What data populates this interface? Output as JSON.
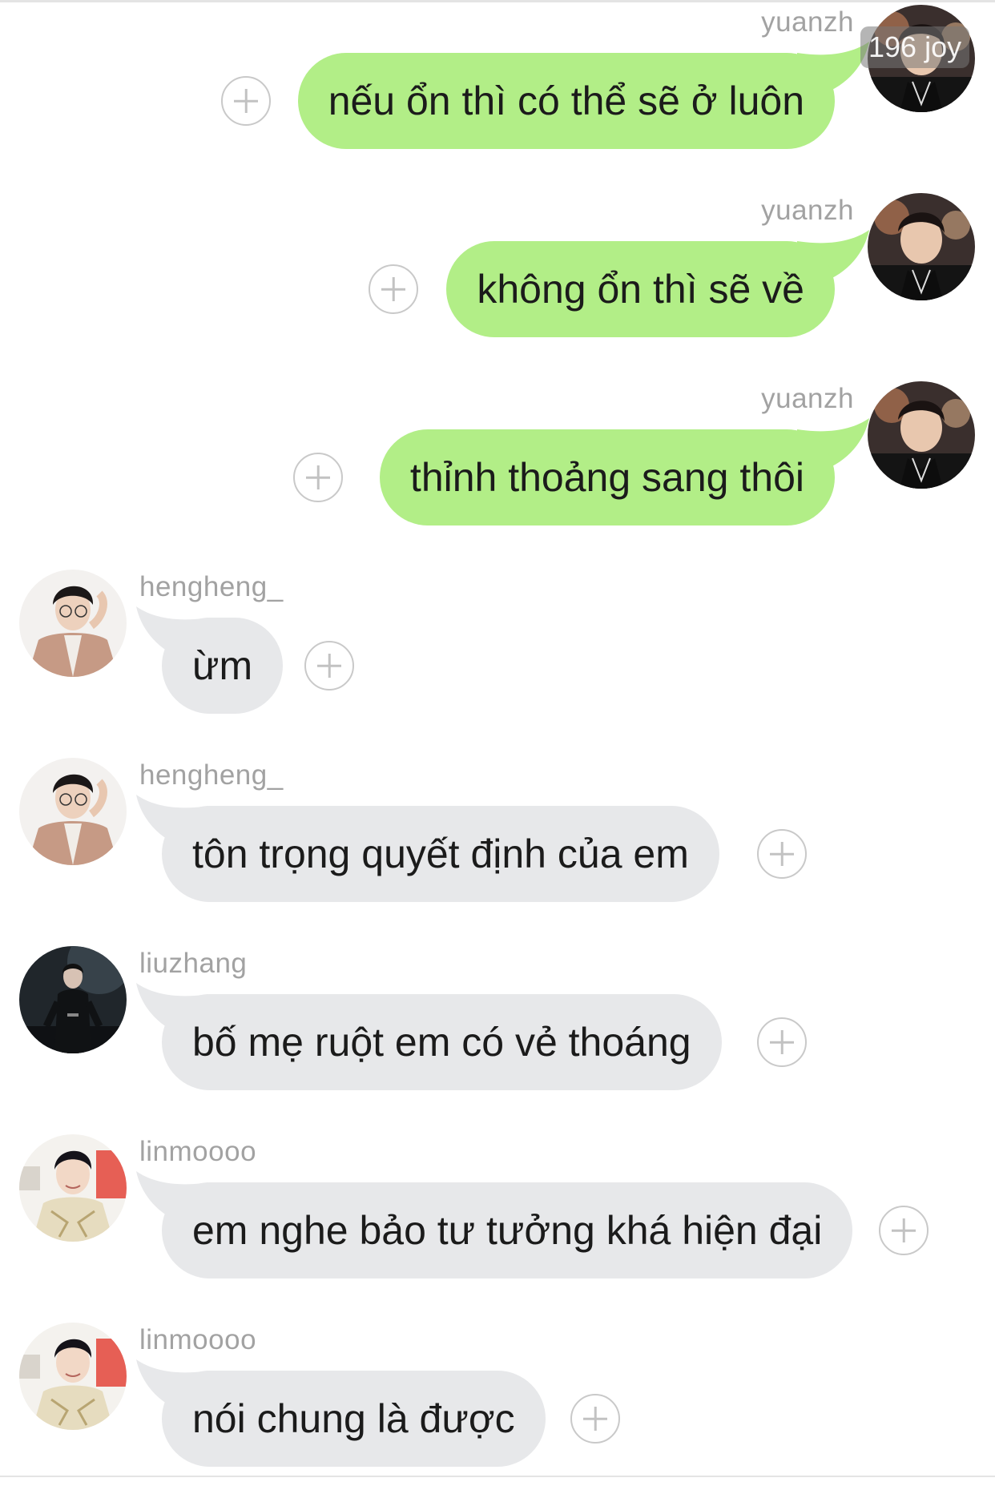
{
  "watermark": "196 joy",
  "messages": [
    {
      "direction": "out",
      "user": "yuanzh",
      "text": "nếu ổn thì có thể sẽ ở luôn",
      "avatar": "avatar-yuanzh"
    },
    {
      "direction": "out",
      "user": "yuanzh",
      "text": "không ổn thì sẽ về",
      "avatar": "avatar-yuanzh"
    },
    {
      "direction": "out",
      "user": "yuanzh",
      "text": "thỉnh thoảng sang thôi",
      "avatar": "avatar-yuanzh"
    },
    {
      "direction": "in",
      "user": "hengheng_",
      "text": "ừm",
      "avatar": "avatar-hengheng"
    },
    {
      "direction": "in",
      "user": "hengheng_",
      "text": "tôn trọng quyết định của em",
      "avatar": "avatar-hengheng"
    },
    {
      "direction": "in",
      "user": "liuzhang",
      "text": "bố mẹ ruột em có vẻ thoáng",
      "avatar": "avatar-liuzhang"
    },
    {
      "direction": "in",
      "user": "linmoooo",
      "text": "em nghe bảo tư tưởng khá hiện đại",
      "avatar": "avatar-linmoooo"
    },
    {
      "direction": "in",
      "user": "linmoooo",
      "text": "nói chung là được",
      "avatar": "avatar-linmoooo"
    }
  ],
  "colors": {
    "outgoing_bubble": "#b2ee87",
    "incoming_bubble": "#e7e8ea",
    "username": "#a2a2a2",
    "plus_icon": "#c9c9c9"
  }
}
